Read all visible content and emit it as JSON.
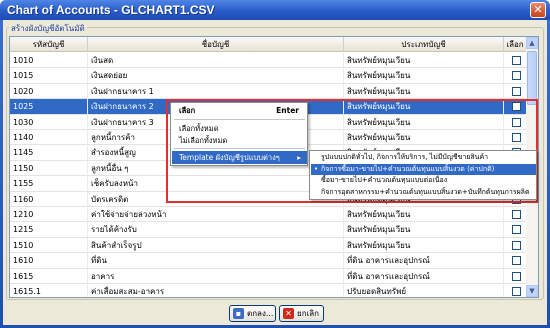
{
  "window": {
    "title": "Chart of Accounts - GLCHART1.CSV",
    "close_glyph": "✕"
  },
  "group": {
    "caption": "สร้างผังบัญชีอัตโนมัติ"
  },
  "grid": {
    "headers": [
      "รหัสบัญชี",
      "ชื่อบัญชี",
      "ประเภทบัญชี",
      "เลือก"
    ],
    "rows": [
      {
        "code": "1010",
        "name": "เงินสด",
        "type": "สินทรัพย์หมุนเวียน",
        "selected": false
      },
      {
        "code": "1015",
        "name": "เงินสดย่อย",
        "type": "สินทรัพย์หมุนเวียน",
        "selected": false
      },
      {
        "code": "1020",
        "name": "เงินฝากธนาคาร 1",
        "type": "สินทรัพย์หมุนเวียน",
        "selected": false
      },
      {
        "code": "1025",
        "name": "เงินฝากธนาคาร 2",
        "type": "สินทรัพย์หมุนเวียน",
        "selected": true
      },
      {
        "code": "1030",
        "name": "เงินฝากธนาคาร 3",
        "type": "สินทรัพย์หมุนเวียน",
        "selected": false
      },
      {
        "code": "1140",
        "name": "ลูกหนี้การค้า",
        "type": "สินทรัพย์หมุนเวียน",
        "selected": false
      },
      {
        "code": "1145",
        "name": "สำรองหนี้สูญ",
        "type": "สินทรัพย์หมุนเวียน",
        "selected": false
      },
      {
        "code": "1150",
        "name": "ลูกหนี้อื่น ๆ",
        "type": "สินทรัพย์หมุนเวียน",
        "selected": false
      },
      {
        "code": "1155",
        "name": "เช็ครับลงหน้า",
        "type": "สินทรัพย์หมุนเวียน",
        "selected": false
      },
      {
        "code": "1160",
        "name": "บัตรเครดิต",
        "type": "สินทรัพย์หมุนเวียน",
        "selected": false
      },
      {
        "code": "1210",
        "name": "ค่าใช้จ่ายจ่ายล่วงหน้า",
        "type": "สินทรัพย์หมุนเวียน",
        "selected": false
      },
      {
        "code": "1215",
        "name": "รายได้ค้างรับ",
        "type": "สินทรัพย์หมุนเวียน",
        "selected": false
      },
      {
        "code": "1510",
        "name": "สินค้าสำเร็จรูป",
        "type": "สินทรัพย์หมุนเวียน",
        "selected": false
      },
      {
        "code": "1610",
        "name": "ที่ดิน",
        "type": "ที่ดิน อาคารและอุปกรณ์",
        "selected": false
      },
      {
        "code": "1615",
        "name": "อาคาร",
        "type": "ที่ดิน อาคารและอุปกรณ์",
        "selected": false
      },
      {
        "code": "1615.1",
        "name": "ค่าเสื่อมสะสม-อาคาร",
        "type": "ปรับยอดสินทรัพย์",
        "selected": false
      }
    ]
  },
  "context_menu": {
    "select_label": "เลือก",
    "select_shortcut": "Enter",
    "select_all_label": "เลือกทั้งหมด",
    "deselect_all_label": "ไม่เลือกทั้งหมด",
    "template_label": "Template ผังบัญชีรูปแบบต่างๆ",
    "submenu_arrow": "▸"
  },
  "submenu": {
    "items": [
      {
        "label": "รูปแบบปกติทั่วไป, กิจการให้บริการ, ไม่มีบัญชีขายสินค้า",
        "checked": false
      },
      {
        "label": "กิจการซื้อมา-ขายไป+คำนวณต้นทุนแบบสิ้นงวด (ค่าปกติ)",
        "checked": true
      },
      {
        "label": "ซื้อมา-ขายไป+คำนวณต้นทุนแบบต่อเนื่อง",
        "checked": false
      },
      {
        "label": "กิจการอุตสาหกรรม+คำนวณต้นทุนแบบสิ้นงวด+บันทึกต้นทุนการผลิต",
        "checked": false
      }
    ],
    "check_glyph": "•"
  },
  "buttons": {
    "ok_label": "ตกลง...",
    "cancel_label": "ยกเลิก",
    "ok_icon": "save-icon",
    "cancel_icon": "x-icon"
  },
  "scrollbar": {
    "up_glyph": "▲",
    "down_glyph": "▼"
  },
  "colors": {
    "selection": "#316ac5",
    "title_bar": "#2a5cc8",
    "highlight_box": "#e03030"
  }
}
